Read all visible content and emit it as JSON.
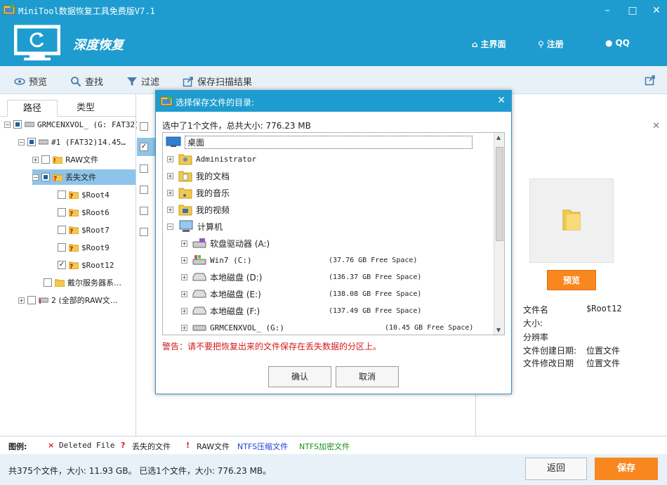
{
  "window": {
    "title": "MiniTool数据恢复工具免费版V7.1"
  },
  "header": {
    "brand": "深度恢复",
    "home": "主界面",
    "register": "注册",
    "qq": "QQ"
  },
  "toolbar": {
    "preview": "预览",
    "search": "查找",
    "filter": "过滤",
    "save_scan": "保存扫描结果"
  },
  "left": {
    "tabs": [
      "路径",
      "类型"
    ],
    "tree": [
      {
        "label": "GRMCENXVOL_ (G: FAT32)"
      },
      {
        "label": "#1 (FAT32)14.45…"
      },
      {
        "label": "RAW文件"
      },
      {
        "label": "丢失文件"
      },
      {
        "label": "$Root4"
      },
      {
        "label": "$Root6"
      },
      {
        "label": "$Root7"
      },
      {
        "label": "$Root9"
      },
      {
        "label": "$Root12"
      },
      {
        "label": "戴尔服务器系…"
      },
      {
        "label": "2 (全部的RAW文…"
      }
    ]
  },
  "right": {
    "preview_button": "预览",
    "info": [
      {
        "label": "文件名",
        "value": "$Root12"
      },
      {
        "label": "大小:",
        "value": ""
      },
      {
        "label": "分辨率",
        "value": ""
      },
      {
        "label": "文件创建日期:",
        "value": "位置文件"
      },
      {
        "label": "文件修改日期",
        "value": "位置文件"
      }
    ]
  },
  "legend": {
    "title": "图例:",
    "deleted": "Deleted File",
    "lost": "丢失的文件",
    "raw": "RAW文件",
    "ntfs_comp": "NTFS压缩文件",
    "ntfs_enc": "NTFS加密文件"
  },
  "status": {
    "text": "共375个文件，大小: 11.93 GB。 已选1个文件，大小: 776.23 MB。",
    "back": "返回",
    "save": "保存"
  },
  "dialog": {
    "title": "选择保存文件的目录:",
    "summary": "选中了1个文件，总共大小: 776.23 MB",
    "nodes": [
      {
        "label": "桌面"
      },
      {
        "label": "Administrator"
      },
      {
        "label": "我的文档"
      },
      {
        "label": "我的音乐"
      },
      {
        "label": "我的视频"
      },
      {
        "label": "计算机"
      },
      {
        "label": "软盘驱动器 (A:)",
        "free": ""
      },
      {
        "label": "Win7 (C:)",
        "free": "(37.76 GB Free Space)"
      },
      {
        "label": "本地磁盘 (D:)",
        "free": "(136.37 GB Free Space)"
      },
      {
        "label": "本地磁盘 (E:)",
        "free": "(138.08 GB Free Space)"
      },
      {
        "label": "本地磁盘 (F:)",
        "free": "(137.49 GB Free Space)"
      },
      {
        "label": "GRMCENXVOL_ (G:)",
        "free": "(10.45 GB Free Space)"
      }
    ],
    "warning": "警告：请不要把恢复出来的文件保存在丢失数据的分区上。",
    "ok": "确认",
    "cancel": "取消"
  },
  "colors": {
    "accent": "#1e9ccf",
    "orange": "#f7871e",
    "warning": "#d21a1a"
  }
}
